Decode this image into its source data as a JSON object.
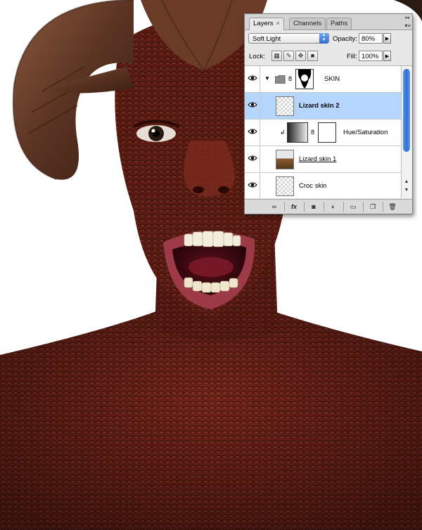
{
  "panel": {
    "tabs": [
      {
        "label": "Layers",
        "close": "×"
      },
      {
        "label": "Channels"
      },
      {
        "label": "Paths"
      }
    ],
    "blend_mode": "Soft Light",
    "opacity_label": "Opacity:",
    "opacity_value": "80%",
    "lock_label": "Lock:",
    "fill_label": "Fill:",
    "fill_value": "100%",
    "layers": [
      {
        "name": "SKIN",
        "type": "group",
        "visible": true
      },
      {
        "name": "Lizard skin 2",
        "type": "layer",
        "visible": true,
        "selected": true
      },
      {
        "name": "Hue/Saturation",
        "type": "adjustment",
        "visible": true
      },
      {
        "name": "Lizard skin 1",
        "type": "layer",
        "visible": true
      },
      {
        "name": "Croc skin",
        "type": "layer",
        "visible": true
      }
    ],
    "footer_buttons": [
      "link-icon",
      "fx-icon",
      "mask-icon",
      "adjustment-icon",
      "folder-icon",
      "new-layer-icon",
      "trash-icon"
    ]
  },
  "colors": {
    "skin": "#7a2a20",
    "selection": "#b5d5fd",
    "accent": "#2f6fd6"
  }
}
